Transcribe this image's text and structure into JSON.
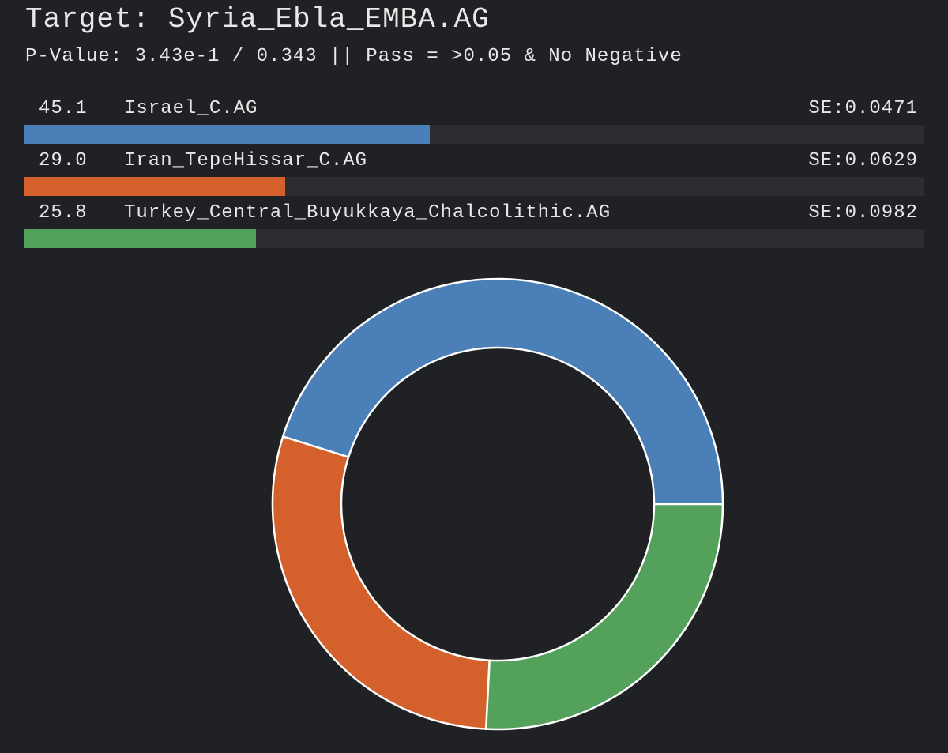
{
  "header": {
    "title": "Target: Syria_Ebla_EMBA.AG",
    "subtitle": "P-Value: 3.43e-1 / 0.343 || Pass = >0.05 & No Negative"
  },
  "chart_data": {
    "type": "pie",
    "categories": [
      "Israel_C.AG",
      "Iran_TepeHissar_C.AG",
      "Turkey_Central_Buyukkaya_Chalcolithic.AG"
    ],
    "values": [
      45.1,
      29.0,
      25.8
    ],
    "value_labels": [
      "45.1",
      "29.0",
      "25.8"
    ],
    "se_labels": [
      "SE:0.0471",
      "SE:0.0629",
      "SE:0.0982"
    ],
    "colors": [
      "#4a7fb8",
      "#d4612b",
      "#54a15c"
    ],
    "bar_max": 100
  }
}
